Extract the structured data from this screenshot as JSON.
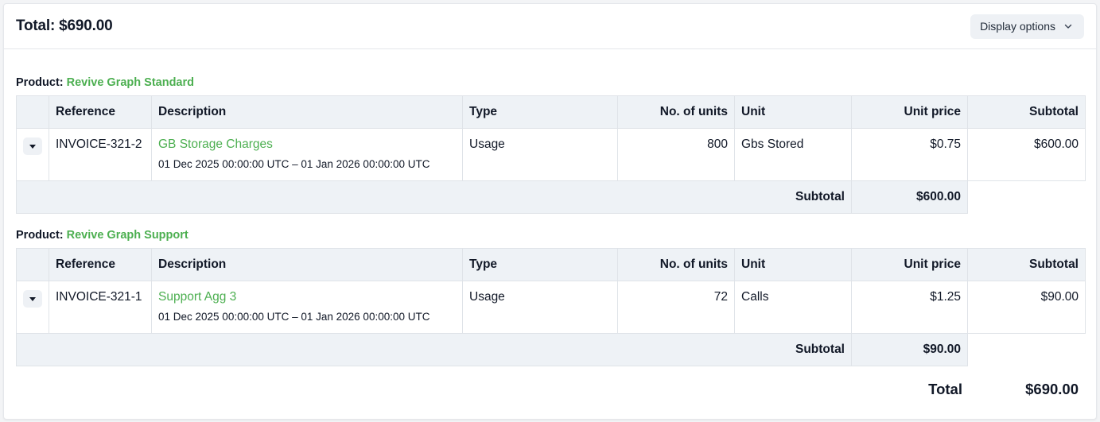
{
  "header": {
    "total_label": "Total: $690.00",
    "display_options_label": "Display options"
  },
  "columns": [
    "Reference",
    "Description",
    "Type",
    "No. of units",
    "Unit",
    "Unit price",
    "Subtotal"
  ],
  "sections": [
    {
      "product_prefix": "Product:",
      "product_name": "Revive Graph Standard",
      "rows": [
        {
          "reference": "INVOICE-321-2",
          "description": "GB Storage Charges",
          "period": "01 Dec 2025 00:00:00 UTC – 01 Jan 2026 00:00:00 UTC",
          "type": "Usage",
          "units": "800",
          "unit": "Gbs Stored",
          "unit_price": "$0.75",
          "subtotal": "$600.00"
        }
      ],
      "subtotal_label": "Subtotal",
      "subtotal_value": "$600.00"
    },
    {
      "product_prefix": "Product:",
      "product_name": "Revive Graph Support",
      "rows": [
        {
          "reference": "INVOICE-321-1",
          "description": "Support Agg 3",
          "period": "01 Dec 2025 00:00:00 UTC – 01 Jan 2026 00:00:00 UTC",
          "type": "Usage",
          "units": "72",
          "unit": "Calls",
          "unit_price": "$1.25",
          "subtotal": "$90.00"
        }
      ],
      "subtotal_label": "Subtotal",
      "subtotal_value": "$90.00"
    }
  ],
  "footer": {
    "total_label": "Total",
    "total_value": "$690.00"
  },
  "colors": {
    "accent_green": "#4caf50",
    "header_bg": "#eef2f6"
  },
  "icons": {
    "display_options": "chevron-down-icon",
    "row_toggle": "caret-down-icon"
  }
}
